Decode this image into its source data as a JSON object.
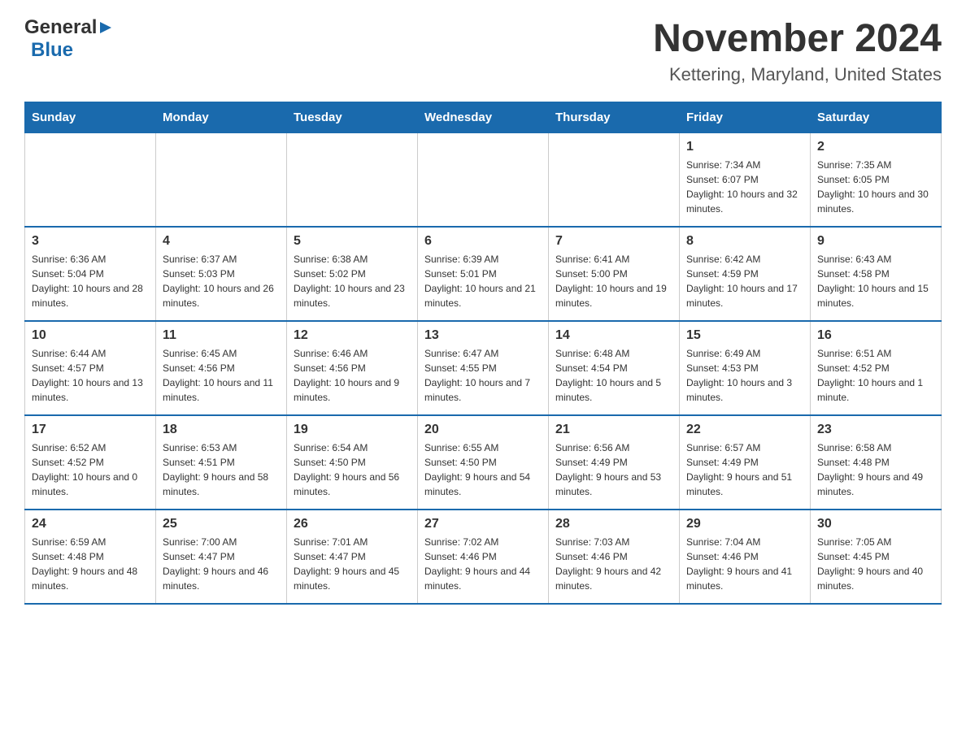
{
  "header": {
    "logo_general": "General",
    "logo_blue": "Blue",
    "title": "November 2024",
    "subtitle": "Kettering, Maryland, United States"
  },
  "weekdays": [
    "Sunday",
    "Monday",
    "Tuesday",
    "Wednesday",
    "Thursday",
    "Friday",
    "Saturday"
  ],
  "weeks": [
    [
      {
        "day": "",
        "info": ""
      },
      {
        "day": "",
        "info": ""
      },
      {
        "day": "",
        "info": ""
      },
      {
        "day": "",
        "info": ""
      },
      {
        "day": "",
        "info": ""
      },
      {
        "day": "1",
        "info": "Sunrise: 7:34 AM\nSunset: 6:07 PM\nDaylight: 10 hours and 32 minutes."
      },
      {
        "day": "2",
        "info": "Sunrise: 7:35 AM\nSunset: 6:05 PM\nDaylight: 10 hours and 30 minutes."
      }
    ],
    [
      {
        "day": "3",
        "info": "Sunrise: 6:36 AM\nSunset: 5:04 PM\nDaylight: 10 hours and 28 minutes."
      },
      {
        "day": "4",
        "info": "Sunrise: 6:37 AM\nSunset: 5:03 PM\nDaylight: 10 hours and 26 minutes."
      },
      {
        "day": "5",
        "info": "Sunrise: 6:38 AM\nSunset: 5:02 PM\nDaylight: 10 hours and 23 minutes."
      },
      {
        "day": "6",
        "info": "Sunrise: 6:39 AM\nSunset: 5:01 PM\nDaylight: 10 hours and 21 minutes."
      },
      {
        "day": "7",
        "info": "Sunrise: 6:41 AM\nSunset: 5:00 PM\nDaylight: 10 hours and 19 minutes."
      },
      {
        "day": "8",
        "info": "Sunrise: 6:42 AM\nSunset: 4:59 PM\nDaylight: 10 hours and 17 minutes."
      },
      {
        "day": "9",
        "info": "Sunrise: 6:43 AM\nSunset: 4:58 PM\nDaylight: 10 hours and 15 minutes."
      }
    ],
    [
      {
        "day": "10",
        "info": "Sunrise: 6:44 AM\nSunset: 4:57 PM\nDaylight: 10 hours and 13 minutes."
      },
      {
        "day": "11",
        "info": "Sunrise: 6:45 AM\nSunset: 4:56 PM\nDaylight: 10 hours and 11 minutes."
      },
      {
        "day": "12",
        "info": "Sunrise: 6:46 AM\nSunset: 4:56 PM\nDaylight: 10 hours and 9 minutes."
      },
      {
        "day": "13",
        "info": "Sunrise: 6:47 AM\nSunset: 4:55 PM\nDaylight: 10 hours and 7 minutes."
      },
      {
        "day": "14",
        "info": "Sunrise: 6:48 AM\nSunset: 4:54 PM\nDaylight: 10 hours and 5 minutes."
      },
      {
        "day": "15",
        "info": "Sunrise: 6:49 AM\nSunset: 4:53 PM\nDaylight: 10 hours and 3 minutes."
      },
      {
        "day": "16",
        "info": "Sunrise: 6:51 AM\nSunset: 4:52 PM\nDaylight: 10 hours and 1 minute."
      }
    ],
    [
      {
        "day": "17",
        "info": "Sunrise: 6:52 AM\nSunset: 4:52 PM\nDaylight: 10 hours and 0 minutes."
      },
      {
        "day": "18",
        "info": "Sunrise: 6:53 AM\nSunset: 4:51 PM\nDaylight: 9 hours and 58 minutes."
      },
      {
        "day": "19",
        "info": "Sunrise: 6:54 AM\nSunset: 4:50 PM\nDaylight: 9 hours and 56 minutes."
      },
      {
        "day": "20",
        "info": "Sunrise: 6:55 AM\nSunset: 4:50 PM\nDaylight: 9 hours and 54 minutes."
      },
      {
        "day": "21",
        "info": "Sunrise: 6:56 AM\nSunset: 4:49 PM\nDaylight: 9 hours and 53 minutes."
      },
      {
        "day": "22",
        "info": "Sunrise: 6:57 AM\nSunset: 4:49 PM\nDaylight: 9 hours and 51 minutes."
      },
      {
        "day": "23",
        "info": "Sunrise: 6:58 AM\nSunset: 4:48 PM\nDaylight: 9 hours and 49 minutes."
      }
    ],
    [
      {
        "day": "24",
        "info": "Sunrise: 6:59 AM\nSunset: 4:48 PM\nDaylight: 9 hours and 48 minutes."
      },
      {
        "day": "25",
        "info": "Sunrise: 7:00 AM\nSunset: 4:47 PM\nDaylight: 9 hours and 46 minutes."
      },
      {
        "day": "26",
        "info": "Sunrise: 7:01 AM\nSunset: 4:47 PM\nDaylight: 9 hours and 45 minutes."
      },
      {
        "day": "27",
        "info": "Sunrise: 7:02 AM\nSunset: 4:46 PM\nDaylight: 9 hours and 44 minutes."
      },
      {
        "day": "28",
        "info": "Sunrise: 7:03 AM\nSunset: 4:46 PM\nDaylight: 9 hours and 42 minutes."
      },
      {
        "day": "29",
        "info": "Sunrise: 7:04 AM\nSunset: 4:46 PM\nDaylight: 9 hours and 41 minutes."
      },
      {
        "day": "30",
        "info": "Sunrise: 7:05 AM\nSunset: 4:45 PM\nDaylight: 9 hours and 40 minutes."
      }
    ]
  ],
  "colors": {
    "header_bg": "#1a6aad",
    "accent_blue": "#1a6aad"
  }
}
